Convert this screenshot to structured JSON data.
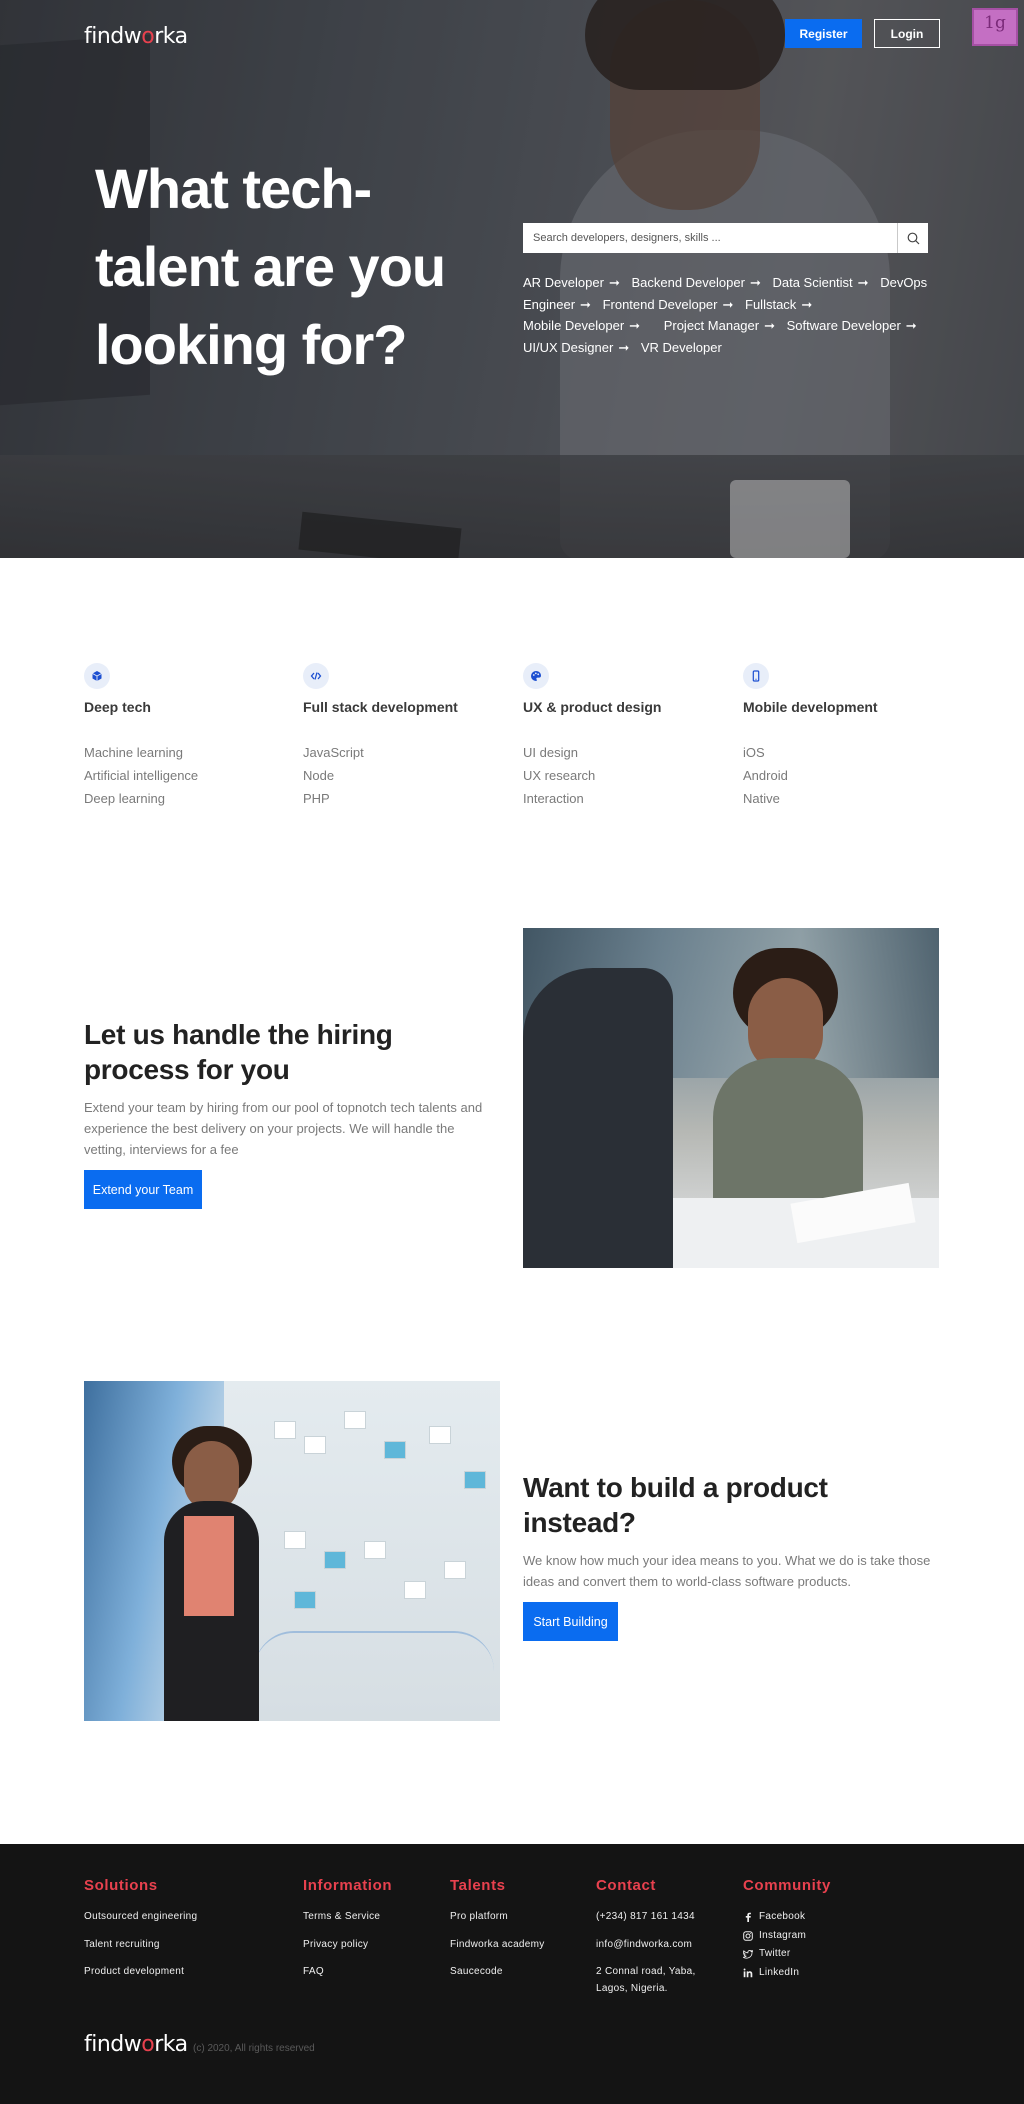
{
  "brand": {
    "logo_prefix": "findw",
    "logo_o": "o",
    "logo_suffix": "rka",
    "accent_color": "#0a6cf0",
    "brand_red": "#e8414e"
  },
  "nav": {
    "register_label": "Register",
    "login_label": "Login",
    "extension_badge": "1g"
  },
  "hero": {
    "title": "What tech-talent are you looking for?",
    "search_placeholder": "Search developers, designers, skills ...",
    "search_icon": "search-icon",
    "roles": [
      "AR Developer",
      "Backend Developer",
      "Data Scientist",
      "DevOps Engineer",
      "Frontend Developer",
      "Fullstack",
      "Mobile Developer",
      "Project Manager",
      "Software Developer",
      "UI/UX Designer",
      "VR Developer"
    ]
  },
  "services": [
    {
      "icon": "cube-icon",
      "title": "Deep tech",
      "items": [
        "Machine learning",
        "Artificial intelligence",
        "Deep learning"
      ]
    },
    {
      "icon": "code-icon",
      "title": "Full stack development",
      "items": [
        "JavaScript",
        "Node",
        "PHP"
      ]
    },
    {
      "icon": "palette-icon",
      "title": "UX & product design",
      "items": [
        "UI design",
        "UX research",
        "Interaction"
      ]
    },
    {
      "icon": "mobile-icon",
      "title": "Mobile development",
      "items": [
        "iOS",
        "Android",
        "Native"
      ]
    }
  ],
  "hiring": {
    "title": "Let us handle the hiring process for you",
    "text": "Extend your team by hiring from our pool of topnotch tech talents and experience the best delivery on your projects. We will handle the vetting, interviews for a fee",
    "cta_label": "Extend your Team"
  },
  "product": {
    "title": "Want to build a product instead?",
    "text": "We know how much your idea means to you. What we do is take those ideas and convert them to world-class software products.",
    "cta_label": "Start Building"
  },
  "footer": {
    "solutions": {
      "title": "Solutions",
      "items": [
        "Outsourced engineering",
        "Talent recruiting",
        "Product development"
      ]
    },
    "information": {
      "title": "Information",
      "items": [
        "Terms & Service",
        "Privacy policy",
        "FAQ"
      ]
    },
    "talents": {
      "title": "Talents",
      "items": [
        "Pro platform",
        "Findworka academy",
        "Saucecode"
      ]
    },
    "contact": {
      "title": "Contact",
      "phone": "(+234) 817 161 1434",
      "email": "info@findworka.com",
      "address": "2 Connal road, Yaba, Lagos, Nigeria."
    },
    "community": {
      "title": "Community",
      "items": [
        {
          "icon": "facebook-icon",
          "label": "Facebook"
        },
        {
          "icon": "instagram-icon",
          "label": "Instagram"
        },
        {
          "icon": "twitter-icon",
          "label": "Twitter"
        },
        {
          "icon": "linkedin-icon",
          "label": "LinkedIn"
        }
      ]
    },
    "copyright": "(c) 2020, All rights reserved"
  }
}
